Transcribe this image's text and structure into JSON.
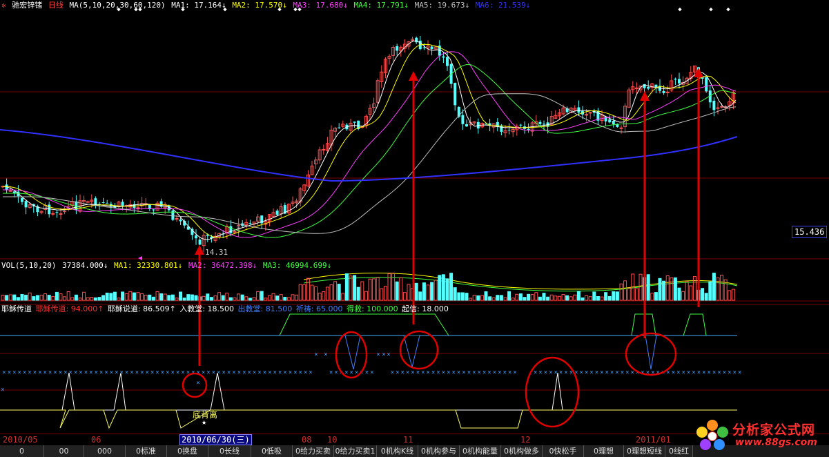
{
  "header": {
    "stock_name": "驰宏锌锗",
    "period": "日线",
    "ma_label": "MA(5,10,20,30,60,120)",
    "ma1": "MA1: 17.164↓",
    "ma2": "MA2: 17.570↓",
    "ma3": "MA3: 17.680↓",
    "ma4": "MA4: 17.791↓",
    "ma5": "MA5: 19.673↓",
    "ma6": "MA6: 21.539↓"
  },
  "price_panel": {
    "current_price": "15.436",
    "low_mark": "14.31"
  },
  "volume_panel": {
    "label": "VOL(5,10,20)",
    "vol": "37384.000↓",
    "ma1": "MA1: 32330.801↓",
    "ma2": "MA2: 36472.398↓",
    "ma3": "MA3: 46994.699↓"
  },
  "indicator_panel": {
    "name": "耶稣传道",
    "v1": "耶稣传道: 94.000↑",
    "v2": "耶稣说道: 86.509↑",
    "v3": "入教堂: 18.500",
    "v4": "出教堂: 81.500",
    "v5": "祈祷: 65.000",
    "v6": "得救: 100.000",
    "v7": "起信: 18.000",
    "divergence_label": "底背离"
  },
  "date_axis": {
    "labels": [
      "2010/05",
      "06",
      "08",
      "10",
      "11",
      "12",
      "2011/01"
    ],
    "selected": "2010/06/30(三)"
  },
  "tabs": [
    "0",
    "00",
    "000",
    "0标准",
    "0换盘",
    "0长线",
    "0低吸",
    "0给力买卖",
    "0给力买卖1",
    "0机构K线",
    "0机构参与",
    "0机构能量",
    "0机构做多",
    "0快松手",
    "0理想",
    "0理想短线",
    "0线红"
  ],
  "watermark": {
    "cn": "分析家公式网",
    "url": "www.88gs.com"
  },
  "colors": {
    "up": "#ff5050",
    "down": "#54ffff",
    "ma1": "#ffffff",
    "ma2": "#ffff00",
    "ma3": "#ff40ff",
    "ma4": "#40ff40",
    "ma5": "#c0c0c0",
    "ma6": "#3030ff",
    "arrow": "#e00000"
  }
}
